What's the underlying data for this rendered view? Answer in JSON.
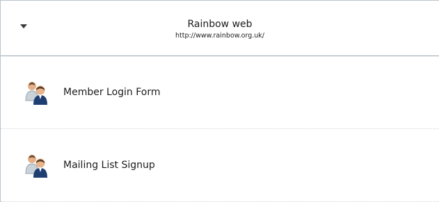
{
  "header": {
    "toggle_icon": "caret-down-icon",
    "title": "Rainbow web",
    "url": "http://www.rainbow.org.uk/"
  },
  "forms": [
    {
      "label": "Member Login Form",
      "icon": "users-icon"
    },
    {
      "label": "Mailing List Signup",
      "icon": "users-icon"
    }
  ],
  "colors": {
    "divider": "#9aa6b1",
    "row_separator": "#d2d6da",
    "panel_border": "#b9c3cc",
    "icon_front_jacket": "#1f3f73",
    "icon_back_person": "#c9d2d9"
  }
}
